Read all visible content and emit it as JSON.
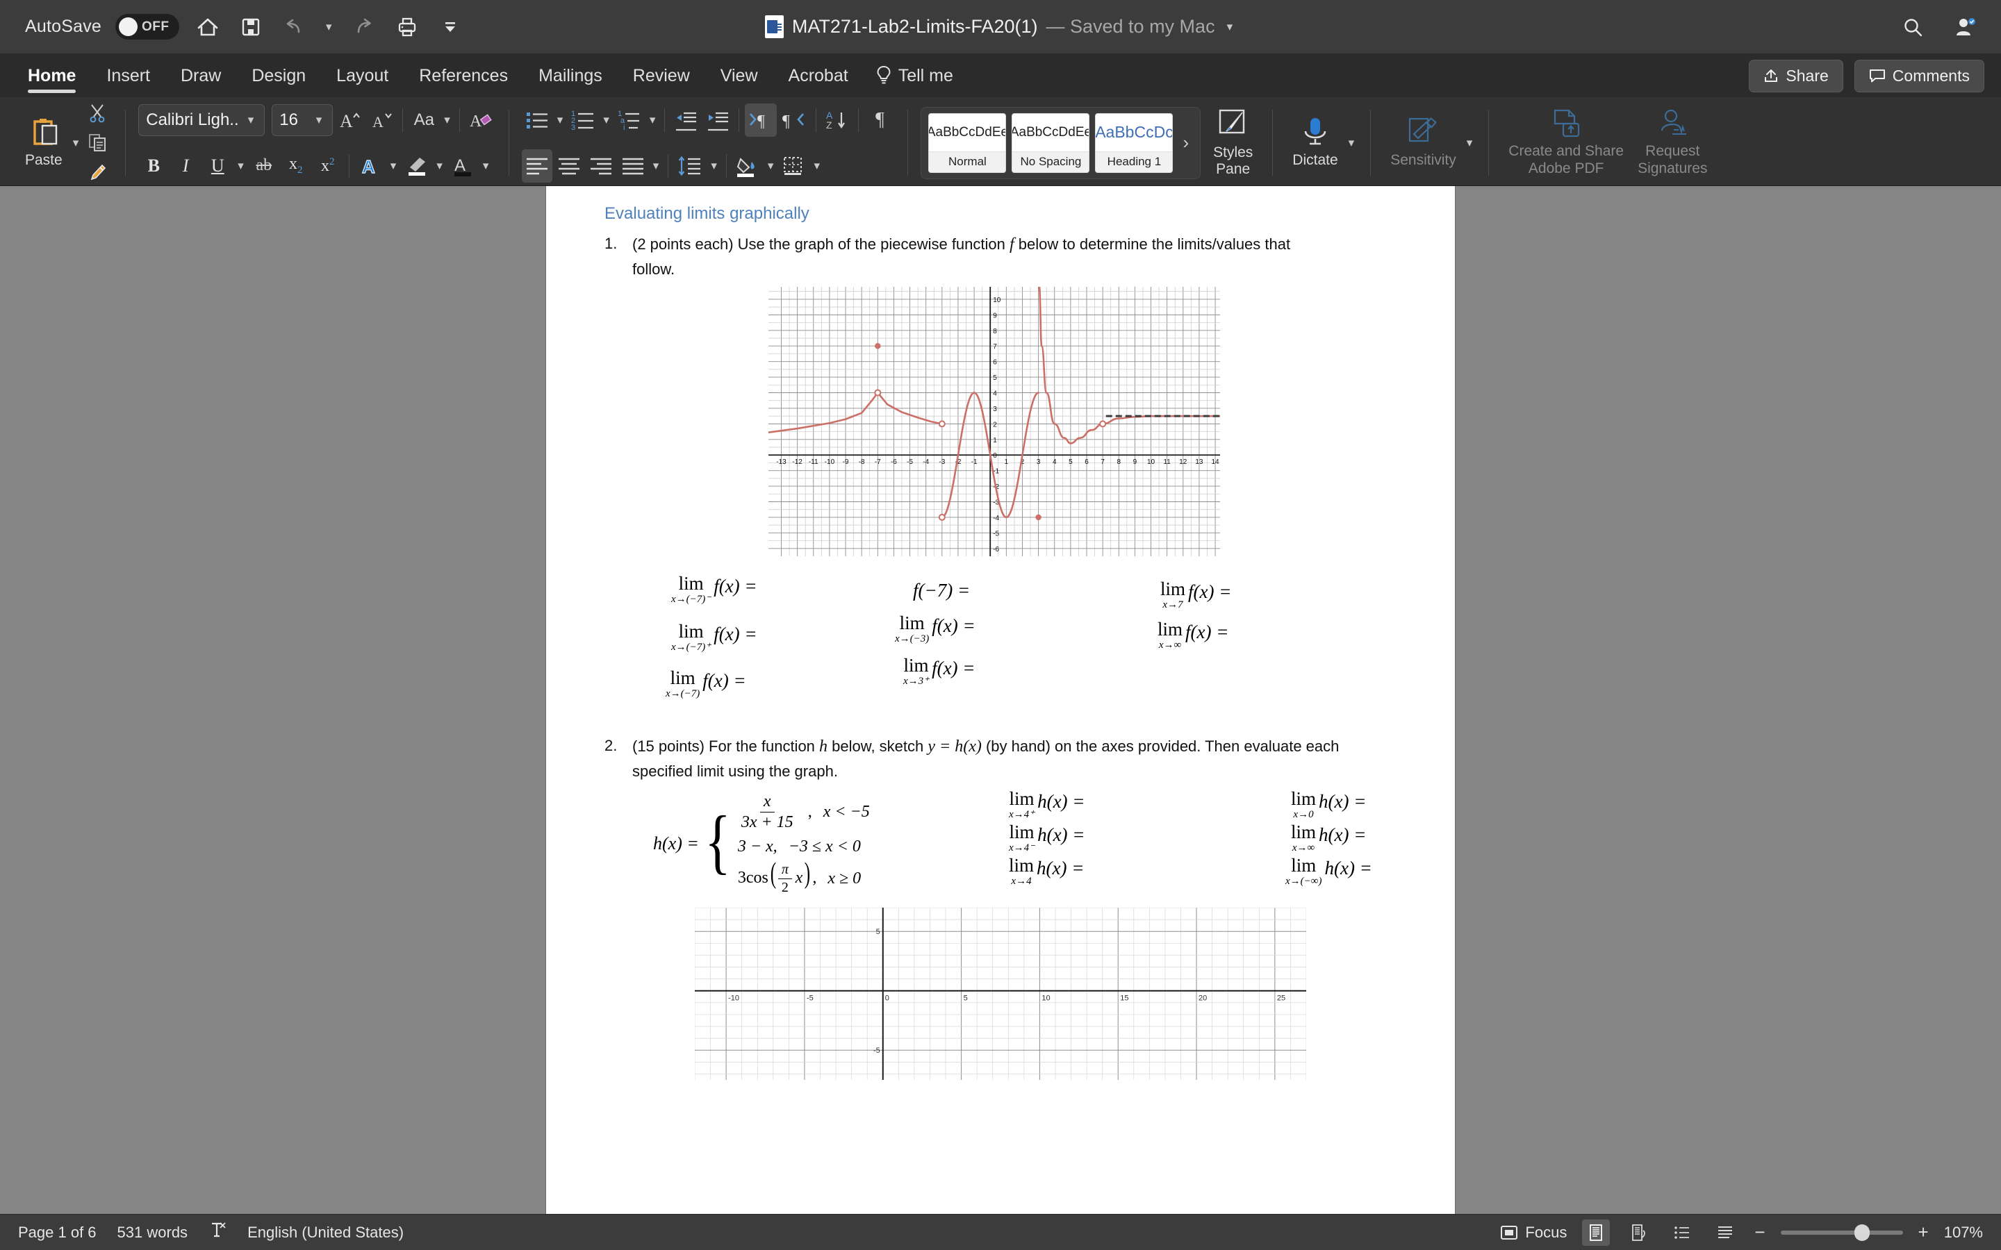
{
  "titlebar": {
    "autosave_label": "AutoSave",
    "autosave_state": "OFF",
    "doc_title": "MAT271-Lab2-Limits-FA20(1)",
    "doc_saved_status": "— Saved to my Mac",
    "icons": [
      "home-icon",
      "save-icon",
      "undo-icon",
      "redo-icon",
      "print-icon",
      "customize-toolbar-icon"
    ],
    "right_icons": [
      "search-icon",
      "account-icon"
    ]
  },
  "ribbon": {
    "tabs": [
      {
        "label": "Home",
        "active": true
      },
      {
        "label": "Insert",
        "active": false
      },
      {
        "label": "Draw",
        "active": false
      },
      {
        "label": "Design",
        "active": false
      },
      {
        "label": "Layout",
        "active": false
      },
      {
        "label": "References",
        "active": false
      },
      {
        "label": "Mailings",
        "active": false
      },
      {
        "label": "Review",
        "active": false
      },
      {
        "label": "View",
        "active": false
      },
      {
        "label": "Acrobat",
        "active": false
      }
    ],
    "tell_me": "Tell me",
    "share_label": "Share",
    "comments_label": "Comments",
    "paste_label": "Paste",
    "font_name": "Calibri Ligh...",
    "font_size": "16",
    "styles": [
      {
        "preview": "AaBbCcDdEe",
        "name": "Normal",
        "heading": false
      },
      {
        "preview": "AaBbCcDdEe",
        "name": "No Spacing",
        "heading": false
      },
      {
        "preview": "AaBbCcDc",
        "name": "Heading 1",
        "heading": true
      }
    ],
    "styles_pane_label": "Styles\nPane",
    "styles_pane_line1": "Styles",
    "styles_pane_line2": "Pane",
    "dictate_label": "Dictate",
    "sensitivity_label": "Sensitivity",
    "adobe_pdf_line1": "Create and Share",
    "adobe_pdf_line2": "Adobe PDF",
    "request_sig_line1": "Request",
    "request_sig_line2": "Signatures",
    "accent_blue": "#3a7ebf",
    "accent_orange": "#e8a33d"
  },
  "document": {
    "heading": "Evaluating limits graphically",
    "q1": {
      "number": "1.",
      "text_a": "(2 points each) Use the graph of the piecewise function",
      "func": "f",
      "text_b": "below to determine the limits/values that",
      "text_c": "follow."
    },
    "q1_limits": {
      "col1": [
        {
          "op": "lim",
          "sub": "x→(−7)⁻",
          "expr": "f(x) ="
        },
        {
          "op": "lim",
          "sub": "x→(−7)⁺",
          "expr": "f(x) ="
        },
        {
          "op": "lim",
          "sub": "x→(−7)",
          "expr": "f(x) ="
        }
      ],
      "col2": [
        {
          "op": "",
          "sub": "",
          "expr": "f(−7) ="
        },
        {
          "op": "lim",
          "sub": "x→(−3)",
          "expr": "f(x) ="
        },
        {
          "op": "lim",
          "sub": "x→3⁺",
          "expr": "f(x) ="
        }
      ],
      "col3": [
        {
          "op": "lim",
          "sub": "x→7",
          "expr": "f(x) ="
        },
        {
          "op": "lim",
          "sub": "x→∞",
          "expr": "f(x) ="
        }
      ]
    },
    "q2": {
      "number": "2.",
      "text_a": "(15 points) For the function",
      "func": "h",
      "text_b": "below, sketch",
      "eq": "y = h(x)",
      "text_c": "(by hand) on the axes provided. Then evaluate each",
      "text_d": "specified limit using the graph."
    },
    "piecewise": {
      "lhs": "h(x) =",
      "rows": [
        {
          "expr_num": "x",
          "expr_den": "3x + 15",
          "is_frac": true,
          "cond": "x < −5"
        },
        {
          "expr": "3 − x,",
          "cond": "−3 ≤ x < 0",
          "is_frac": false
        },
        {
          "expr": "3cos(π/2 x),",
          "cond": "x ≥ 0",
          "is_frac": false,
          "is_cos": true
        }
      ]
    },
    "q2_limits": {
      "col1": [
        {
          "op": "lim",
          "sub": "x→4⁺",
          "expr": "h(x) ="
        },
        {
          "op": "lim",
          "sub": "x→4⁻",
          "expr": "h(x) ="
        },
        {
          "op": "lim",
          "sub": "x→4",
          "expr": "h(x) ="
        }
      ],
      "col2": [
        {
          "op": "lim",
          "sub": "x→0",
          "expr": "h(x) ="
        },
        {
          "op": "lim",
          "sub": "x→∞",
          "expr": "h(x) ="
        },
        {
          "op": "lim",
          "sub": "x→(−∞)",
          "expr": "h(x) ="
        }
      ]
    }
  },
  "chart_data": [
    {
      "type": "line",
      "title": "Graph of piecewise function f",
      "xlabel": "",
      "ylabel": "",
      "xlim": [
        -13.8,
        14.3
      ],
      "ylim": [
        -6.5,
        10.8
      ],
      "xticks": [
        -13,
        -12,
        -11,
        -10,
        -9,
        -8,
        -7,
        -6,
        -5,
        -4,
        -3,
        -2,
        -1,
        0,
        1,
        2,
        3,
        4,
        5,
        6,
        7,
        8,
        9,
        10,
        11,
        12,
        13,
        14
      ],
      "yticks": [
        -6,
        -5,
        -4,
        -3,
        -2,
        -1,
        0,
        1,
        2,
        3,
        4,
        5,
        6,
        7,
        8,
        9,
        10
      ],
      "grid": true,
      "curve_color": "#cc6f66",
      "asymptote_color": "#3d3d3d",
      "series": [
        {
          "name": "branch-left",
          "comment": "rises from (-13.8,1.5) to open circle at (-7,4)",
          "points": [
            [
              -13.8,
              1.45
            ],
            [
              -12,
              1.7
            ],
            [
              -10,
              2.05
            ],
            [
              -9,
              2.3
            ],
            [
              -8,
              2.7
            ],
            [
              -7.4,
              3.45
            ],
            [
              -7,
              4.0
            ]
          ]
        },
        {
          "name": "branch-mid",
          "comment": "from open circle (-7,4) falling to open circle (-3,2)",
          "points": [
            [
              -7,
              4.0
            ],
            [
              -6.4,
              3.25
            ],
            [
              -5.5,
              2.75
            ],
            [
              -4.5,
              2.4
            ],
            [
              -3.7,
              2.15
            ],
            [
              -3,
              2.0
            ]
          ]
        },
        {
          "name": "branch-oscillating",
          "comment": "oscillation between x=-3 and x=3 amplitude 4",
          "points": [
            [
              -3,
              -4
            ],
            [
              -2,
              4
            ],
            [
              -1,
              -4
            ],
            [
              0,
              4
            ],
            [
              1,
              -4
            ],
            [
              2,
              4
            ],
            [
              3,
              -4
            ]
          ]
        },
        {
          "name": "branch-asymptote",
          "comment": "vertical blowup near x=3 then decays to horizontal asymptote y=2.5",
          "points": [
            [
              3.05,
              10.8
            ],
            [
              3.2,
              7
            ],
            [
              3.5,
              4
            ],
            [
              4,
              2
            ],
            [
              4.6,
              1.1
            ],
            [
              5,
              0.75
            ],
            [
              5.6,
              1.1
            ],
            [
              6.3,
              1.6
            ],
            [
              7,
              2.0
            ]
          ]
        },
        {
          "name": "branch-right",
          "comment": "from open circle (7,2) approaching horizontal asymptote y=2.5",
          "points": [
            [
              7,
              2.0
            ],
            [
              8,
              2.35
            ],
            [
              9,
              2.45
            ],
            [
              10,
              2.5
            ],
            [
              12,
              2.5
            ],
            [
              14.3,
              2.5
            ]
          ]
        }
      ],
      "horizontal_asymptote": {
        "y": 2.5,
        "x_start": 7.2,
        "x_end": 14.3,
        "style": "dashed"
      },
      "markers": [
        {
          "x": -7,
          "y": 7,
          "type": "filled"
        },
        {
          "x": -7,
          "y": 4,
          "type": "open"
        },
        {
          "x": -3,
          "y": 2,
          "type": "open"
        },
        {
          "x": -3,
          "y": -4,
          "type": "open"
        },
        {
          "x": 3,
          "y": -4,
          "type": "filled"
        },
        {
          "x": 7,
          "y": 2,
          "type": "open"
        }
      ]
    },
    {
      "type": "line",
      "title": "Blank axes for sketching y = h(x)",
      "xlabel": "",
      "ylabel": "",
      "xlim": [
        -12,
        27
      ],
      "ylim": [
        -7.5,
        7
      ],
      "xticks": [
        -10,
        -5,
        0,
        5,
        10,
        15,
        20,
        25
      ],
      "yticks": [
        5,
        0,
        -5
      ],
      "xticklabels": [
        "-10",
        "-5",
        "0",
        "5",
        "10",
        "15",
        "20",
        "25"
      ],
      "yticklabels": [
        "5",
        "",
        "-5"
      ],
      "grid": true,
      "minor_grid_step": 1,
      "major_grid_step": 5,
      "series": []
    }
  ],
  "statusbar": {
    "page_info": "Page 1 of 6",
    "word_count": "531 words",
    "proofing_icon": "proofing-errors-icon",
    "language": "English (United States)",
    "focus_label": "Focus",
    "view_icons": [
      "print-layout-icon",
      "web-layout-icon",
      "outline-icon",
      "draft-icon"
    ],
    "zoom_level": "107%",
    "zoom_out": "−",
    "zoom_in": "+"
  }
}
